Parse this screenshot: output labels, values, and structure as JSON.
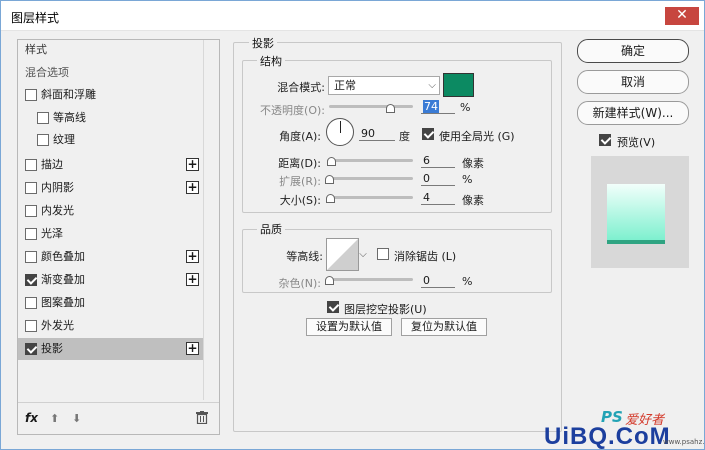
{
  "window": {
    "title": "图层样式",
    "close_label": "✕"
  },
  "styles_panel": {
    "header": "样式",
    "blend_options": "混合选项",
    "items": [
      {
        "label": "斜面和浮雕",
        "checked": false,
        "has_plus": false
      },
      {
        "label": "等高线",
        "checked": false,
        "has_plus": false
      },
      {
        "label": "纹理",
        "checked": false,
        "has_plus": false
      },
      {
        "label": "描边",
        "checked": false,
        "has_plus": true
      },
      {
        "label": "内阴影",
        "checked": false,
        "has_plus": true
      },
      {
        "label": "内发光",
        "checked": false,
        "has_plus": false
      },
      {
        "label": "光泽",
        "checked": false,
        "has_plus": false
      },
      {
        "label": "颜色叠加",
        "checked": false,
        "has_plus": true
      },
      {
        "label": "渐变叠加",
        "checked": true,
        "has_plus": true
      },
      {
        "label": "图案叠加",
        "checked": false,
        "has_plus": false
      },
      {
        "label": "外发光",
        "checked": false,
        "has_plus": false
      },
      {
        "label": "投影",
        "checked": true,
        "has_plus": true,
        "selected": true
      }
    ],
    "footer": {
      "fx": "fx",
      "up": "⬆",
      "down": "⬇"
    }
  },
  "drop_shadow": {
    "title": "投影",
    "structure": {
      "title": "结构",
      "blend_mode_label": "混合模式:",
      "blend_mode_value": "正常",
      "shadow_color": "#0c8a62",
      "opacity_label": "不透明度(O):",
      "opacity_value": "74",
      "opacity_unit": "%",
      "angle_label": "角度(A):",
      "angle_value": "90",
      "angle_unit": "度",
      "global_light_label": "使用全局光 (G)",
      "global_light_checked": true,
      "distance_label": "距离(D):",
      "distance_value": "6",
      "distance_unit": "像素",
      "spread_label": "扩展(R):",
      "spread_value": "0",
      "spread_unit": "%",
      "size_label": "大小(S):",
      "size_value": "4",
      "size_unit": "像素"
    },
    "quality": {
      "title": "品质",
      "contour_label": "等高线:",
      "antialias_label": "消除锯齿 (L)",
      "antialias_checked": false,
      "noise_label": "杂色(N):",
      "noise_value": "0",
      "noise_unit": "%"
    },
    "knockout_label": "图层挖空投影(U)",
    "knockout_checked": true,
    "make_default": "设置为默认值",
    "reset_default": "复位为默认值"
  },
  "buttons": {
    "ok": "确定",
    "cancel": "取消",
    "new_style": "新建样式(W)...",
    "preview_label": "预览(V)",
    "preview_checked": true
  },
  "watermark": {
    "ps": "PS",
    "cn": "爱好者",
    "site": "UiBQ.CoM",
    "url": "www.psahz.com"
  }
}
